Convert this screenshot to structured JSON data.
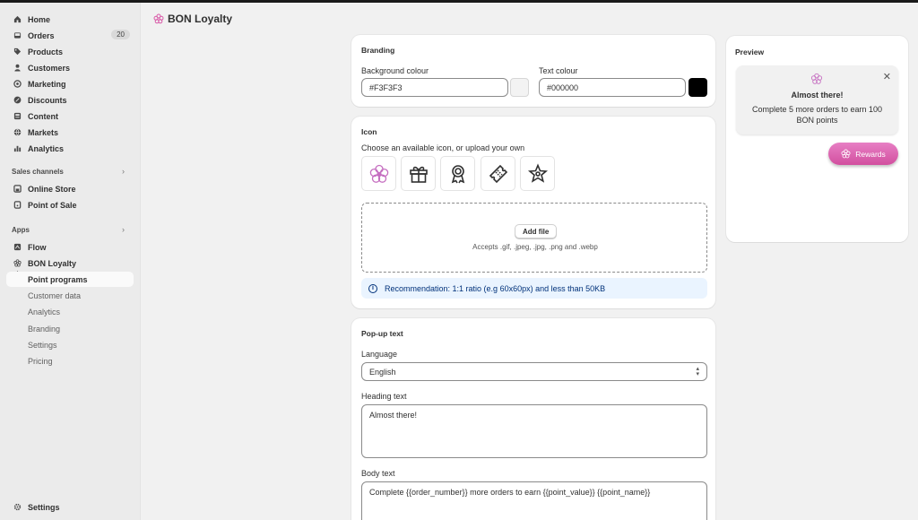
{
  "sidebar": {
    "items": [
      {
        "label": "Home",
        "icon": "home-icon"
      },
      {
        "label": "Orders",
        "icon": "inbox-icon",
        "badge": "20"
      },
      {
        "label": "Products",
        "icon": "tag-icon"
      },
      {
        "label": "Customers",
        "icon": "person-icon"
      },
      {
        "label": "Marketing",
        "icon": "target-icon"
      },
      {
        "label": "Discounts",
        "icon": "discount-icon"
      },
      {
        "label": "Content",
        "icon": "content-icon"
      },
      {
        "label": "Markets",
        "icon": "globe-icon"
      },
      {
        "label": "Analytics",
        "icon": "chart-bar-icon"
      }
    ],
    "sales_channels_label": "Sales channels",
    "channels": [
      {
        "label": "Online Store",
        "icon": "store-icon"
      },
      {
        "label": "Point of Sale",
        "icon": "pos-icon"
      }
    ],
    "apps_label": "Apps",
    "apps": [
      {
        "label": "Flow",
        "icon": "flow-icon"
      },
      {
        "label": "BON Loyalty",
        "icon": "flower-icon"
      }
    ],
    "subitems": [
      "Point programs",
      "Customer data",
      "Analytics",
      "Branding",
      "Settings",
      "Pricing"
    ],
    "settings_label": "Settings"
  },
  "header": {
    "title": "BON Loyalty"
  },
  "branding": {
    "title": "Branding",
    "bg_label": "Background colour",
    "bg_value": "#F3F3F3",
    "bg_color": "#F3F3F3",
    "text_label": "Text colour",
    "text_value": "#000000",
    "text_color": "#000000"
  },
  "icon_section": {
    "title": "Icon",
    "subtitle": "Choose an available icon, or upload your own",
    "options": [
      "flower-icon",
      "gift-icon",
      "award-ribbon-icon",
      "ticket-icon",
      "star-puzzle-icon"
    ],
    "add_file": "Add file",
    "accepts": "Accepts .gif, .jpeg, .jpg, .png and .webp",
    "recommendation": "Recommendation: 1:1 ratio (e.g 60x60px) and less than 50KB"
  },
  "popup_text": {
    "title": "Pop-up text",
    "language_label": "Language",
    "language_value": "English",
    "heading_label": "Heading text",
    "heading_value": "Almost there!",
    "body_label": "Body text",
    "body_value": "Complete {{order_number}} more orders to earn {{point_value}} {{point_name}}"
  },
  "preview": {
    "title": "Preview",
    "heading": "Almost there!",
    "body": "Complete 5 more orders to earn 100 BON points",
    "rewards_label": "Rewards",
    "accent": "#D95AA8"
  }
}
